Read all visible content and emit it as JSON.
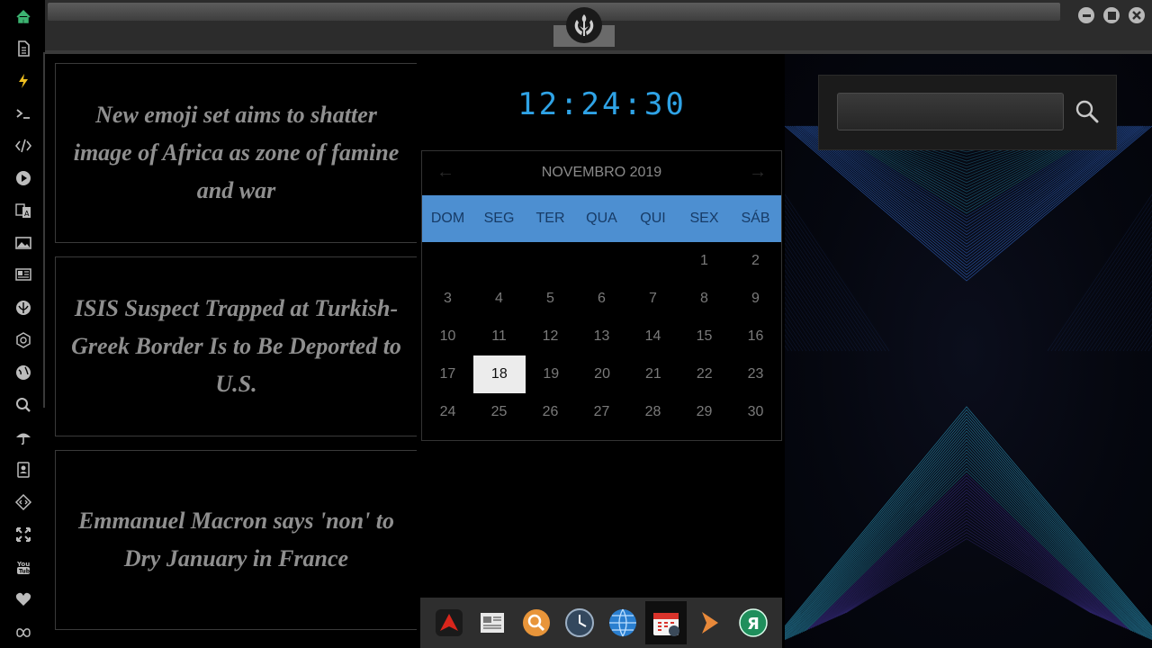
{
  "sidebar": {
    "icons": [
      "home-icon",
      "document-icon",
      "lightning-icon",
      "terminal-icon",
      "code-icon",
      "play-icon",
      "translate-icon",
      "image-icon",
      "news-icon",
      "rebel-alliance-icon",
      "empire-icon",
      "globe-icon",
      "search-icon",
      "umbrella-icon",
      "contacts-icon",
      "diamond-code-icon",
      "fullscreen-icon",
      "youtube-icon",
      "heart-icon",
      "infinity-cloud-icon"
    ],
    "active_color": "#3cb371"
  },
  "topbar": {
    "logo": "rebel-alliance-logo-icon"
  },
  "news": {
    "items": [
      {
        "headline": "New emoji set aims to shatter image of Africa as zone of famine and war"
      },
      {
        "headline": "ISIS Suspect Trapped at Turkish-Greek Border Is to Be Deported to U.S."
      },
      {
        "headline": "Emmanuel Macron says 'non' to Dry January in France"
      }
    ]
  },
  "clock": {
    "time": "12:24:30",
    "color": "#2fa3e6"
  },
  "calendar": {
    "title": "NOVEMBRO 2019",
    "prev_icon": "arrow-left-icon",
    "next_icon": "arrow-right-icon",
    "day_names": [
      "DOM",
      "SEG",
      "TER",
      "QUA",
      "QUI",
      "SEX",
      "SÁB"
    ],
    "weeks": [
      [
        "",
        "",
        "",
        "",
        "",
        "1",
        "2"
      ],
      [
        "3",
        "4",
        "5",
        "6",
        "7",
        "8",
        "9"
      ],
      [
        "10",
        "11",
        "12",
        "13",
        "14",
        "15",
        "16"
      ],
      [
        "17",
        "18",
        "19",
        "20",
        "21",
        "22",
        "23"
      ],
      [
        "24",
        "25",
        "26",
        "27",
        "28",
        "29",
        "30"
      ]
    ],
    "today": "18",
    "header_color": "#4d8fd1"
  },
  "dock": {
    "items": [
      {
        "name": "dock-app-red-icon",
        "active": false
      },
      {
        "name": "dock-newspaper-icon",
        "active": false
      },
      {
        "name": "dock-search-icon",
        "active": false
      },
      {
        "name": "dock-clock-icon",
        "active": false
      },
      {
        "name": "dock-globe-icon",
        "active": false
      },
      {
        "name": "dock-calendar-icon",
        "active": true
      },
      {
        "name": "dock-arrow-icon",
        "active": false
      },
      {
        "name": "dock-yandex-icon",
        "active": false
      }
    ]
  },
  "search": {
    "value": "",
    "placeholder": "",
    "button_icon": "magnifier-icon"
  }
}
